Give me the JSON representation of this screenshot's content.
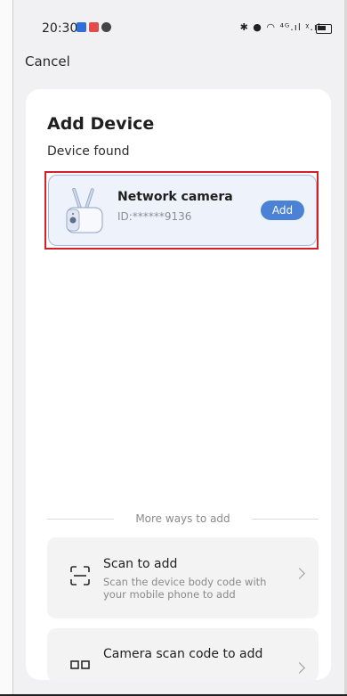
{
  "status_bar": {
    "time": "20:30",
    "signal_text": "⁴ᴳ.ıl ᵡ.ıl"
  },
  "nav": {
    "cancel_label": "Cancel"
  },
  "sheet": {
    "title": "Add Device",
    "subtitle": "Device found",
    "device": {
      "name": "Network camera",
      "id": "ID:******9136",
      "add_label": "Add"
    },
    "more_ways_label": "More ways to add",
    "options": [
      {
        "title": "Scan to add",
        "description": "Scan the device body code with your mobile phone to add",
        "icon": "scan-icon"
      },
      {
        "title": "Camera scan code to add",
        "description": "",
        "icon": "qr-code-icon"
      }
    ]
  },
  "colors": {
    "accent": "#4c82d6",
    "highlight_border": "#d5202a",
    "card_bg": "#eef2fa"
  }
}
